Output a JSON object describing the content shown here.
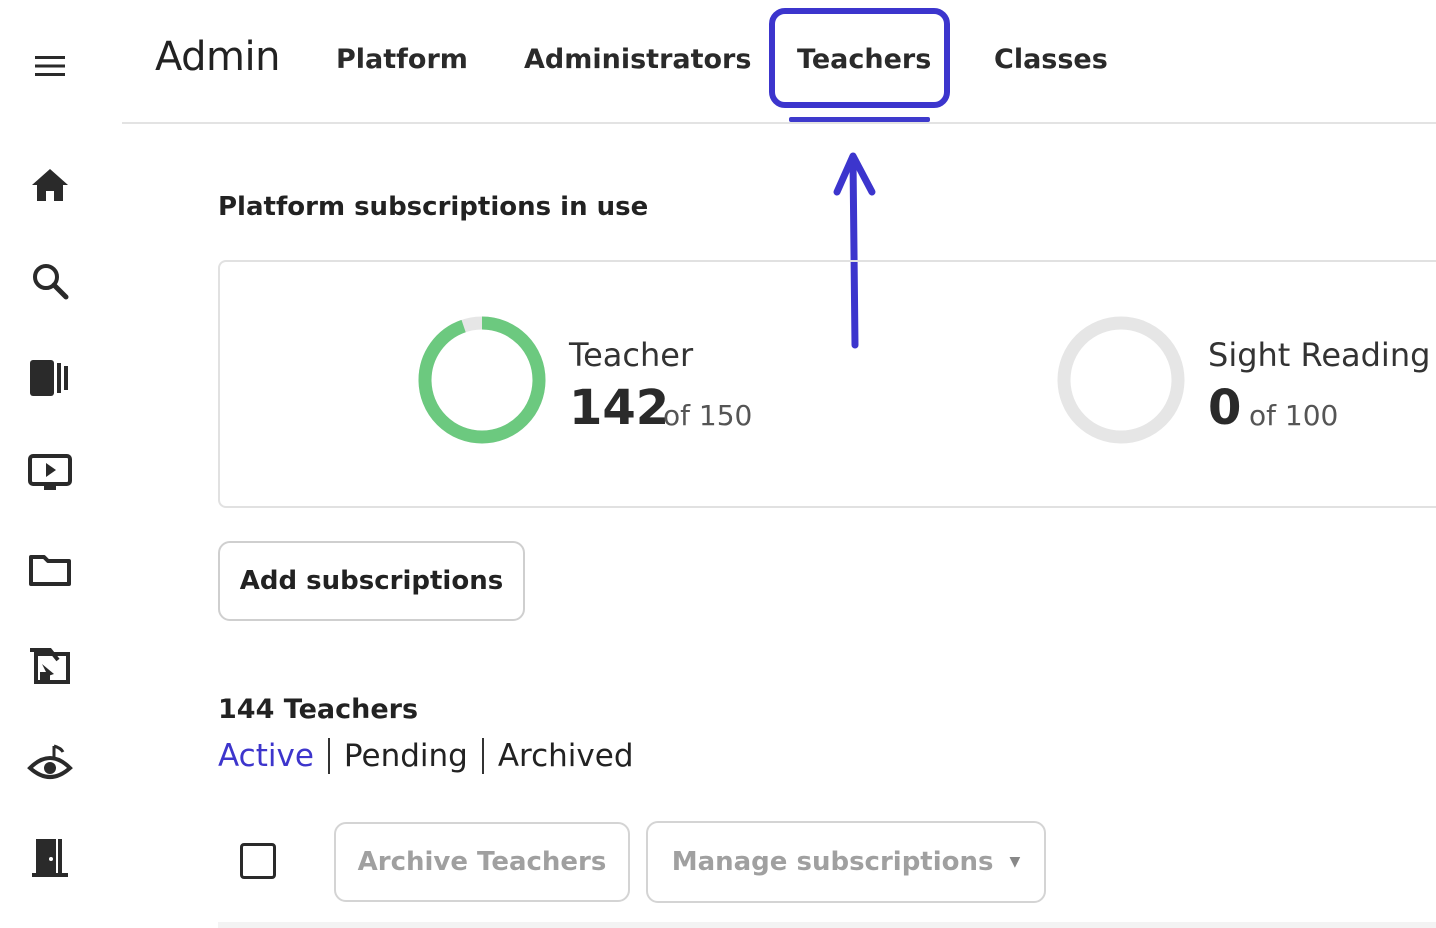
{
  "nav": {
    "brand": "Admin",
    "tabs": [
      {
        "label": "Platform"
      },
      {
        "label": "Administrators"
      },
      {
        "label": "Teachers"
      },
      {
        "label": "Classes"
      }
    ],
    "active_tab": "Teachers"
  },
  "sidebar": {
    "icons": [
      "menu-icon",
      "home-icon",
      "search-icon",
      "library-icon",
      "video-icon",
      "folder-icon",
      "assignment-icon",
      "sight-reading-icon",
      "exit-icon"
    ]
  },
  "subscriptions": {
    "title": "Platform subscriptions in use",
    "items": [
      {
        "name": "Teacher",
        "used": "142",
        "of_label": "of 150",
        "fraction": 0.9467,
        "color": "#6cc97f"
      },
      {
        "name": "Sight Reading",
        "used": "0",
        "of_label": "of 100",
        "fraction": 0,
        "color": "#6cc97f"
      }
    ],
    "track_color": "#e6e6e6",
    "add_button": "Add subscriptions"
  },
  "teachers": {
    "count_title": "144 Teachers",
    "filters": [
      {
        "label": "Active"
      },
      {
        "label": "Pending"
      },
      {
        "label": "Archived"
      }
    ],
    "archive_button": "Archive Teachers",
    "manage_button": "Manage subscriptions"
  },
  "colors": {
    "accent": "#3d35cc",
    "highlight": "#3c35cd"
  }
}
